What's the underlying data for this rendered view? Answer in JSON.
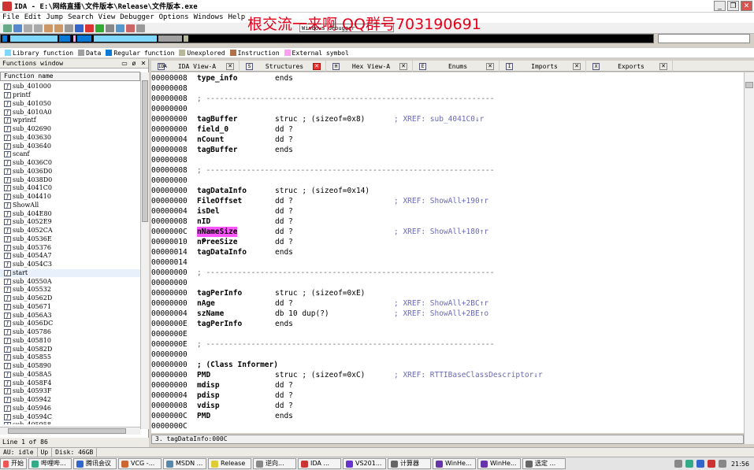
{
  "window": {
    "title": "IDA - E:\\网络直播\\文件版本\\Release\\文件版本.exe"
  },
  "menu": [
    "File",
    "Edit",
    "Jump",
    "Search",
    "View",
    "Debugger",
    "Options",
    "Windows",
    "Help"
  ],
  "watermark": "根交流一来啊 QQ群号703190691",
  "toolbar": {
    "debugger_select": "Windows debugger"
  },
  "legend": [
    {
      "label": "Library function",
      "color": "#7fd7ff"
    },
    {
      "label": "Data",
      "color": "#a0a0a0"
    },
    {
      "label": "Regular function",
      "color": "#0a7ad6"
    },
    {
      "label": "Unexplored",
      "color": "#b7b79a"
    },
    {
      "label": "Instruction",
      "color": "#b0714a"
    },
    {
      "label": "External symbol",
      "color": "#ff9ef2"
    }
  ],
  "functions_window": {
    "title": "Functions window",
    "column": "Function name",
    "items": [
      "sub_401000",
      "printf",
      "sub_401050",
      "sub_4010A0",
      "wprintf",
      "sub_402690",
      "sub_403630",
      "sub_403640",
      "scanf",
      "sub_4036C0",
      "sub_4036D0",
      "sub_4038D0",
      "sub_4041C0",
      "sub_404410",
      "ShowAll",
      "sub_404E80",
      "sub_4052E9",
      "sub_4052CA",
      "sub_40536E",
      "sub_405376",
      "sub_4054A7",
      "sub_4054C3",
      "start",
      "sub_40550A",
      "sub_405532",
      "sub_40562D",
      "sub_405671",
      "sub_4056A3",
      "sub_4056DC",
      "sub_405786",
      "sub_405810",
      "sub_40582D",
      "sub_405855",
      "sub_405890",
      "sub_4058A5",
      "sub_4058F4",
      "sub_40593F",
      "sub_405942",
      "sub_405946",
      "sub_40594C",
      "sub_405958"
    ],
    "selected": "start",
    "footer": "Line 1 of 86"
  },
  "tabs": [
    {
      "label": "IDA View-A",
      "icon": "IDA"
    },
    {
      "label": "Structures",
      "icon": "S",
      "close_red": true
    },
    {
      "label": "Hex View-A",
      "icon": "H"
    },
    {
      "label": "Enums",
      "icon": "E"
    },
    {
      "label": "Imports",
      "icon": "I"
    },
    {
      "label": "Exports",
      "icon": "X"
    }
  ],
  "code_lines": [
    {
      "a": "00000008",
      "n": "type_info",
      "o": "ends"
    },
    {
      "a": "00000008"
    },
    {
      "a": "00000008",
      "sep": "; ----------------------------------------------------------------"
    },
    {
      "a": "00000000"
    },
    {
      "a": "00000000",
      "n": "tagBuffer",
      "o": "struc ; (sizeof=0x8)",
      "x": "; XREF: sub_4041C0↓r"
    },
    {
      "a": "00000000",
      "n": "field_0",
      "o": "dd ?"
    },
    {
      "a": "00000004",
      "n": "nCount",
      "o": "dd ?"
    },
    {
      "a": "00000008",
      "n": "tagBuffer",
      "o": "ends"
    },
    {
      "a": "00000008"
    },
    {
      "a": "00000008",
      "sep": "; ----------------------------------------------------------------"
    },
    {
      "a": "00000000"
    },
    {
      "a": "00000000",
      "n": "tagDataInfo",
      "o": "struc ; (sizeof=0x14)"
    },
    {
      "a": "00000000",
      "n": "FileOffset",
      "o": "dd ?",
      "x": "; XREF: ShowAll+190↑r"
    },
    {
      "a": "00000004",
      "n": "isDel",
      "o": "dd ?"
    },
    {
      "a": "00000008",
      "n": "nID",
      "o": "dd ?"
    },
    {
      "a": "0000000C",
      "n": "nNameSize",
      "o": "dd ?",
      "x": "; XREF: ShowAll+180↑r",
      "hl": true
    },
    {
      "a": "00000010",
      "n": "nFreeSize",
      "o": "dd ?"
    },
    {
      "a": "00000014",
      "n": "tagDataInfo",
      "o": "ends"
    },
    {
      "a": "00000014"
    },
    {
      "a": "00000000",
      "sep": "; ----------------------------------------------------------------"
    },
    {
      "a": "00000000"
    },
    {
      "a": "00000000",
      "n": "tagPerInfo",
      "o": "struc ; (sizeof=0xE)"
    },
    {
      "a": "00000000",
      "n": "nAge",
      "o": "dd ?",
      "x": "; XREF: ShowAll+2BC↑r"
    },
    {
      "a": "00000004",
      "n": "szName",
      "o": "db 10 dup(?)",
      "x": "; XREF: ShowAll+2BE↑o"
    },
    {
      "a": "0000000E",
      "n": "tagPerInfo",
      "o": "ends"
    },
    {
      "a": "0000000E"
    },
    {
      "a": "0000000E",
      "sep": "; ----------------------------------------------------------------"
    },
    {
      "a": "00000000"
    },
    {
      "a": "00000000",
      "n": "; (Class Informer)"
    },
    {
      "a": "00000000",
      "n": "PMD",
      "o": "struc ; (sizeof=0xC)",
      "x": "; XREF: RTTIBaseClassDescriptor↓r"
    },
    {
      "a": "00000000",
      "n": "mdisp",
      "o": "dd ?"
    },
    {
      "a": "00000004",
      "n": "pdisp",
      "o": "dd ?"
    },
    {
      "a": "00000008",
      "n": "vdisp",
      "o": "dd ?"
    },
    {
      "a": "0000000C",
      "n": "PMD",
      "o": "ends"
    },
    {
      "a": "0000000C"
    }
  ],
  "code_status": "3. tagDataInfo:000C",
  "statusbar": [
    "AU:  idle",
    "Up",
    "Disk: 46GB"
  ],
  "taskbar": {
    "start": "开始",
    "items": [
      "哔哩哔...",
      "腾讯会议",
      "VCG -...",
      "MSDN ...",
      "Release",
      "逆向...",
      "IDA ...",
      "VS201...",
      "计算器",
      "WinHe...",
      "WinHe...",
      "选定 ..."
    ],
    "clock": "21:56"
  }
}
